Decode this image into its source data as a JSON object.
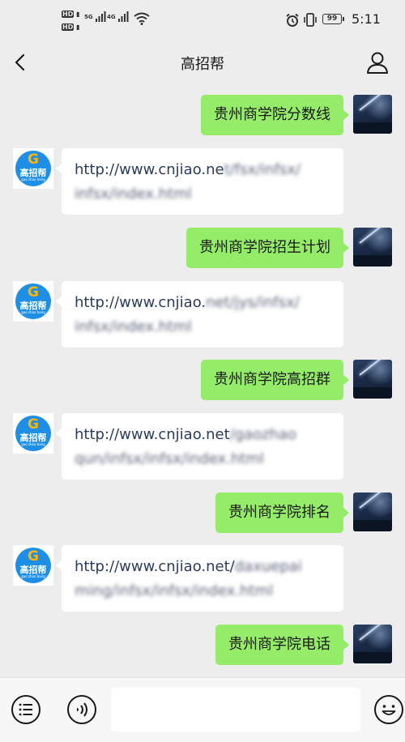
{
  "status_bar": {
    "sim1_label": "HD",
    "sim2_label": "HD",
    "net1_label": "5G",
    "net2_label": "4G",
    "battery": "99",
    "time": "5:11"
  },
  "header": {
    "title": "高招帮"
  },
  "avatar_bot": {
    "glyph": "G",
    "brand": "高招帮",
    "sub": "gao zhao bang"
  },
  "messages": [
    {
      "side": "right",
      "text": "贵州商学院分数线"
    },
    {
      "side": "left",
      "link_visible": "http://www.cnjiao.ne",
      "link_blurred": "t/fsx/infsx/",
      "line2_blurred": "infsx/index.html"
    },
    {
      "side": "right",
      "text": "贵州商学院招生计划"
    },
    {
      "side": "left",
      "link_visible": "http://www.cnjiao.",
      "link_blurred": "net/jys/infsx/",
      "line2_blurred": "infsx/index.html"
    },
    {
      "side": "right",
      "text": "贵州商学院高招群"
    },
    {
      "side": "left",
      "link_visible": "http://www.cnjiao.net",
      "link_blurred": "/gaozhao",
      "line2_blurred": "qun/infsx/infsx/index.html"
    },
    {
      "side": "right",
      "text": "贵州商学院排名"
    },
    {
      "side": "left",
      "link_visible": "http://www.cnjiao.net/",
      "link_blurred": "daxuepai",
      "line2_blurred": "ming/infsx/infsx/index.html"
    },
    {
      "side": "right",
      "text": "贵州商学院电话"
    }
  ],
  "input": {
    "value": ""
  },
  "colors": {
    "background": "#ededed",
    "bubble_sent": "#95ec69",
    "bubble_received": "#ffffff",
    "link_text": "#2b3c5f",
    "bot_avatar": "#1f8fe6"
  },
  "icons": {
    "back": "chevron-left-icon",
    "profile": "person-icon",
    "menu": "list-icon",
    "voice": "voice-icon",
    "emoji": "smiley-icon"
  }
}
